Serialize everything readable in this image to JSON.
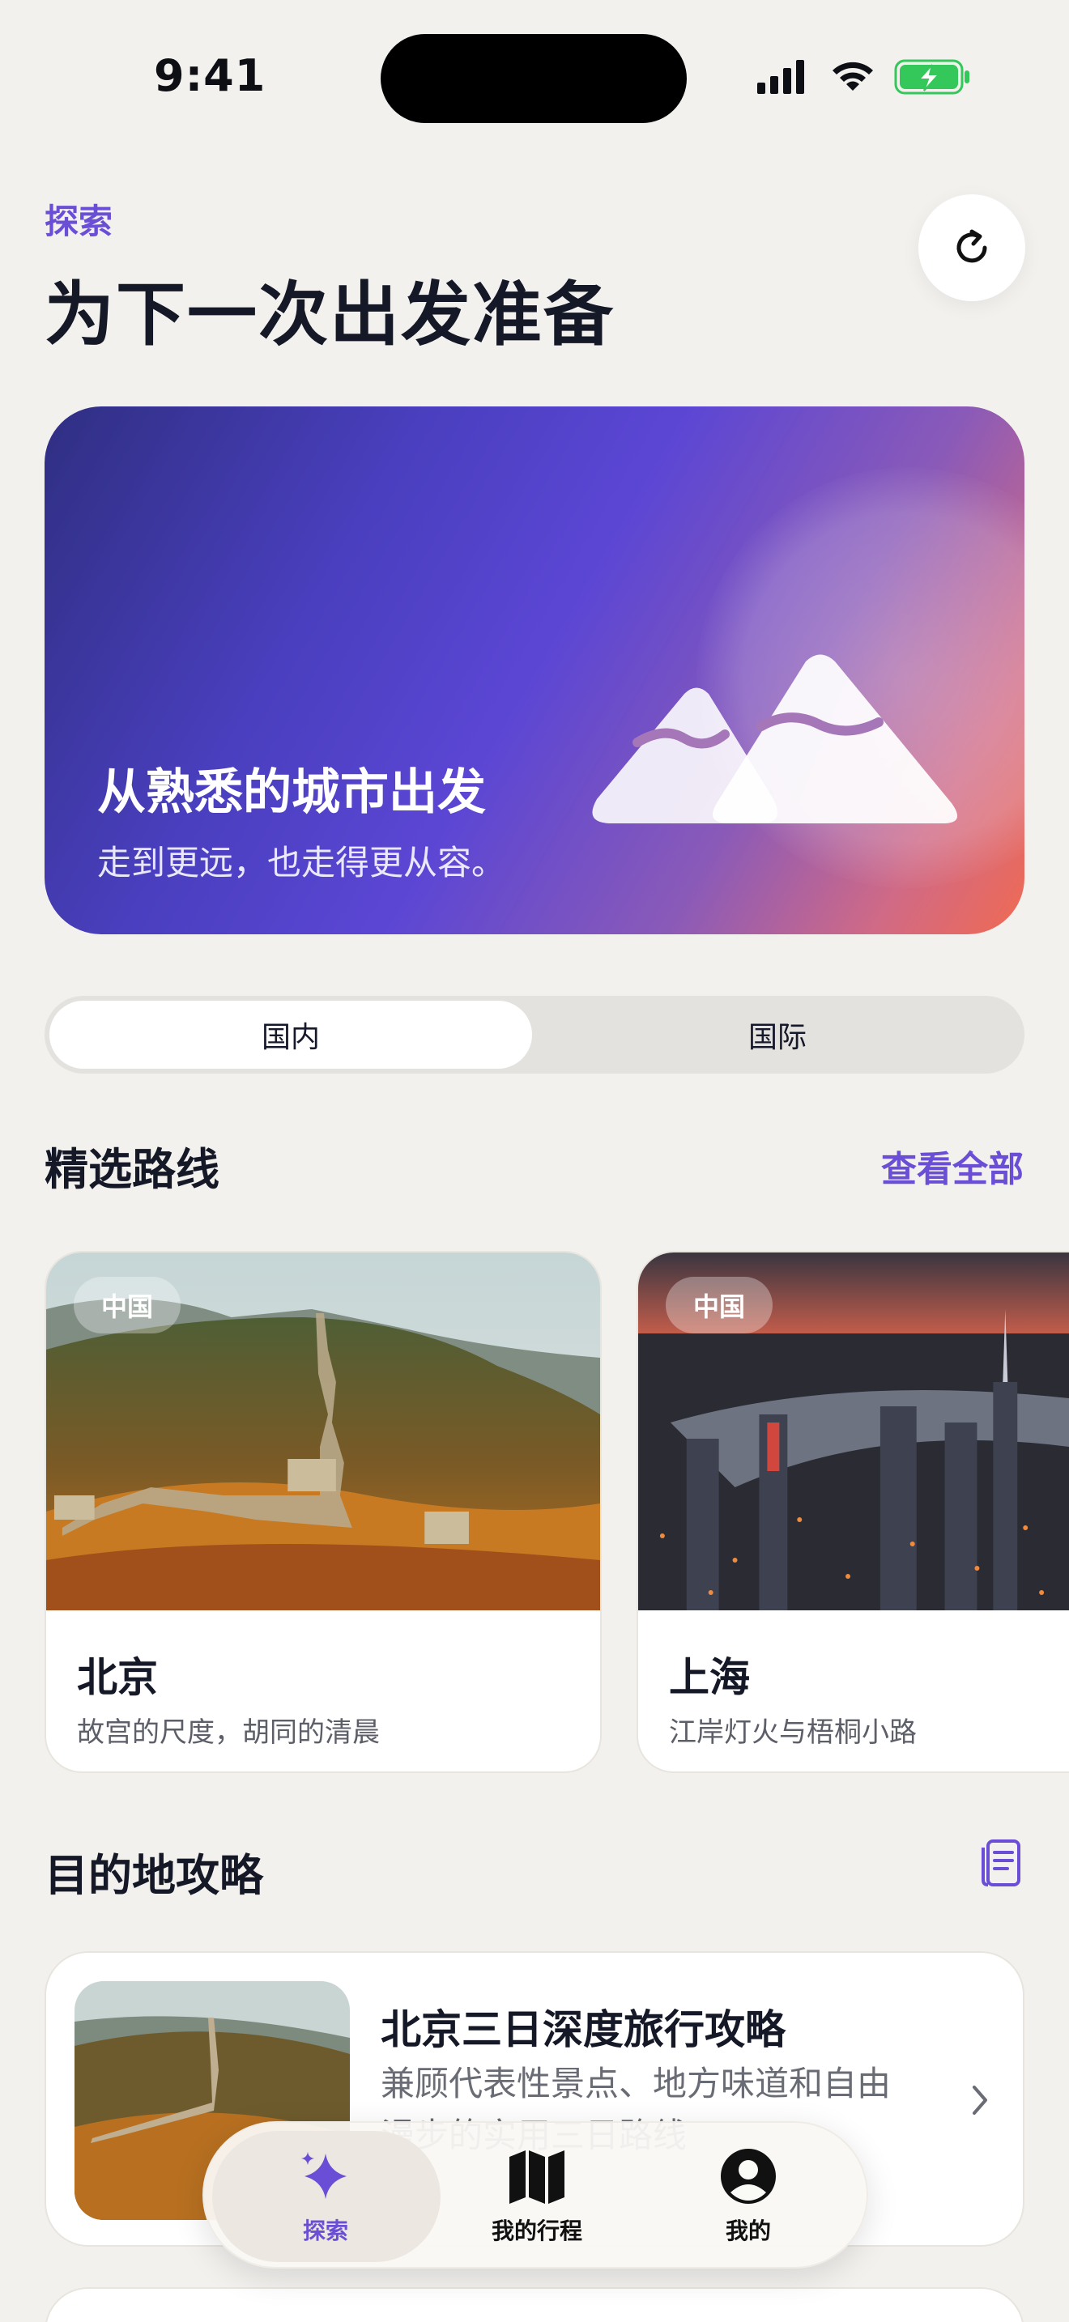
{
  "status_bar": {
    "time": "9:41"
  },
  "header": {
    "eyebrow": "探索",
    "title": "为下一次出发准备"
  },
  "hero": {
    "title": "从熟悉的城市出发",
    "subtitle": "走到更远，也走得更从容。"
  },
  "segment": {
    "options": [
      "国内",
      "国际"
    ],
    "selected": "国内"
  },
  "routes": {
    "section_title": "精选路线",
    "see_all": "查看全部",
    "items": [
      {
        "chip": "中国",
        "name": "北京",
        "desc": "故宫的尺度，胡同的清晨"
      },
      {
        "chip": "中国",
        "name": "上海",
        "desc": "江岸灯火与梧桐小路"
      }
    ]
  },
  "guides": {
    "section_title": "目的地攻略",
    "items": [
      {
        "title": "北京三日深度旅行攻略",
        "desc": "兼顾代表性景点、地方味道和自由漫步的实用三日路线"
      }
    ]
  },
  "tabbar": {
    "items": [
      {
        "label": "探索",
        "icon": "sparkle-icon",
        "active": true
      },
      {
        "label": "我的行程",
        "icon": "map-icon",
        "active": false
      },
      {
        "label": "我的",
        "icon": "profile-icon",
        "active": false
      }
    ]
  },
  "colors": {
    "accent": "#6a4fd6",
    "background": "#f3f1ee",
    "battery": "#34c759"
  }
}
